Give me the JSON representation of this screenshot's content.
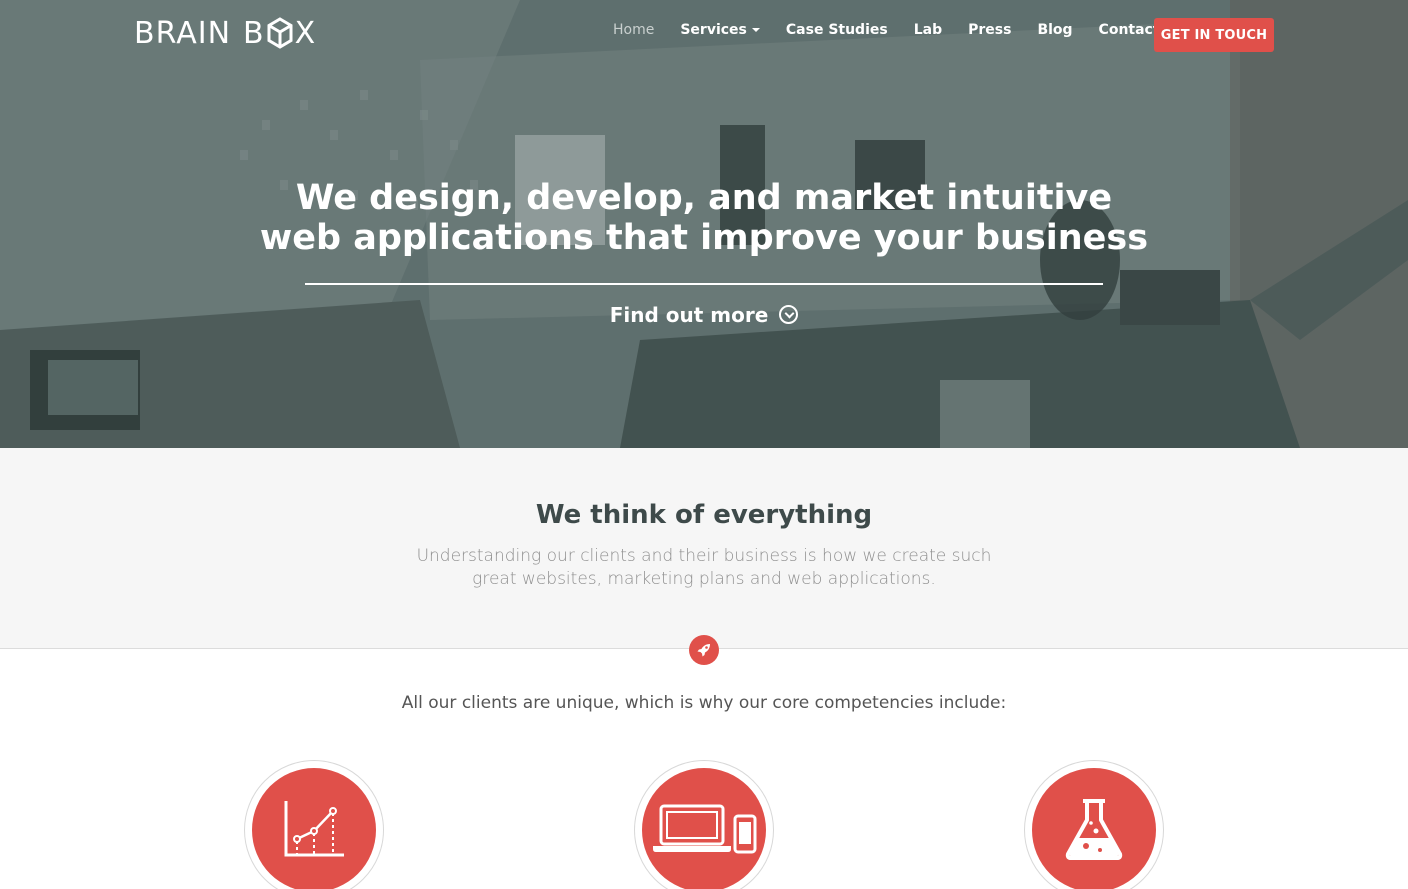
{
  "brand": {
    "name_left": "BRAIN",
    "name_right": "B",
    "name_end": "X",
    "logo_icon": "cube-icon"
  },
  "nav": {
    "items": [
      {
        "label": "Home",
        "active": true
      },
      {
        "label": "Services",
        "has_dropdown": true
      },
      {
        "label": "Case Studies"
      },
      {
        "label": "Lab"
      },
      {
        "label": "Press"
      },
      {
        "label": "Blog"
      },
      {
        "label": "Contact Us"
      }
    ],
    "cta_label": "GET IN TOUCH"
  },
  "hero": {
    "title_line1": "We design, develop, and market intuitive",
    "title_line2": "web applications that improve your business",
    "find_more_label": "Find out more",
    "find_more_icon": "chevron-down-circle-icon"
  },
  "think": {
    "title": "We think of everything",
    "subtitle": "Understanding our clients and their business is how we create such great websites, marketing plans and web applications."
  },
  "divider_icon": "rocket-icon",
  "competencies": {
    "intro": "All our clients are unique, which is why our core competencies include:",
    "items": [
      {
        "icon": "line-chart-icon"
      },
      {
        "icon": "laptop-phone-icon"
      },
      {
        "icon": "flask-icon"
      }
    ]
  },
  "colors": {
    "accent": "#e0504a",
    "hero_overlay": "#4a5857",
    "section_bg": "#f6f6f6",
    "heading": "#3e4a4a"
  }
}
